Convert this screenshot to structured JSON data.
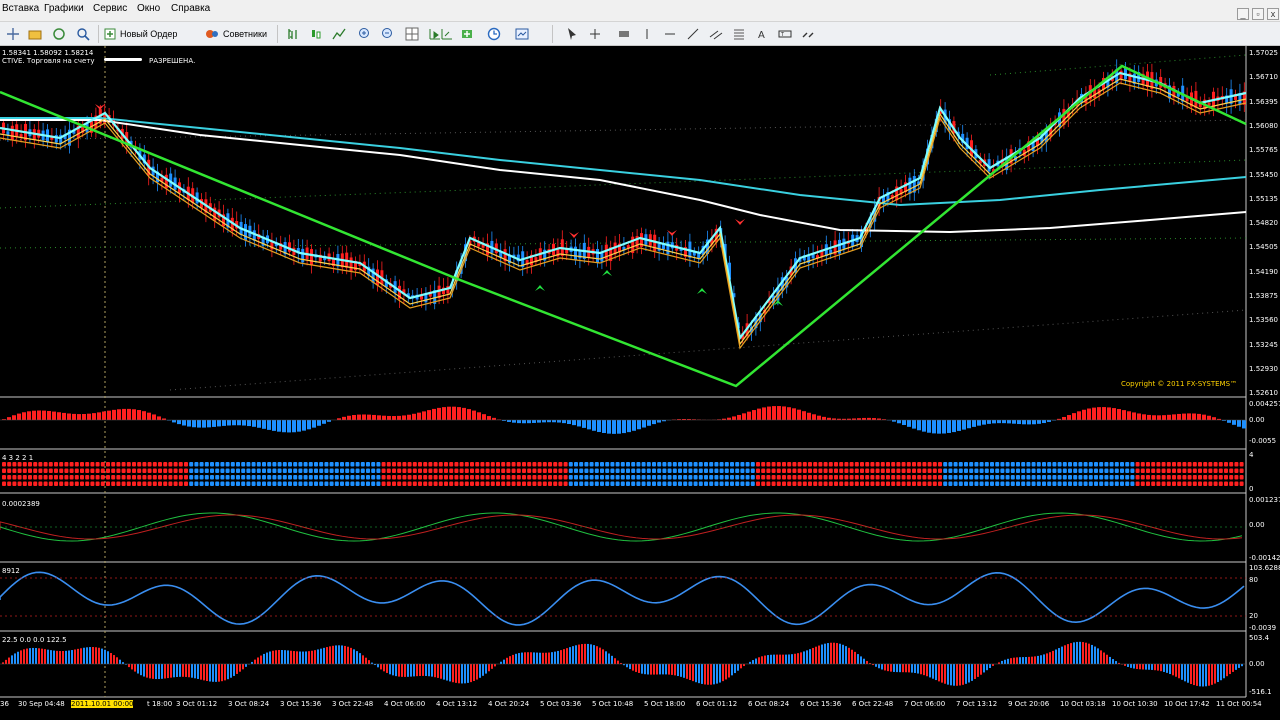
{
  "menu": [
    "Вставка",
    "Графики",
    "Сервис",
    "Окно",
    "Справка"
  ],
  "toolbar": {
    "new_order_label": "Новый Ордер",
    "advisors_label": "Советники"
  },
  "header": {
    "ohlc": "1.58341 1.58092 1.58214",
    "status_prefix": "CTIVE. Торговля на счету",
    "status_suffix": "РАЗРЕШЕНА."
  },
  "price_axis": [
    "1.57025",
    "1.56710",
    "1.56395",
    "1.56080",
    "1.55765",
    "1.55450",
    "1.55135",
    "1.54820",
    "1.54505",
    "1.54190",
    "1.53875",
    "1.53560",
    "1.53245",
    "1.52930",
    "1.52610"
  ],
  "copyright": "Copyright © 2011 FX-SYSTEMS™",
  "sub1": {
    "axis": [
      "0.004257",
      "0.00",
      "-0.0055"
    ]
  },
  "sub2": {
    "label": "4 3 2 2 1",
    "axis": [
      "4",
      "0"
    ]
  },
  "sub3": {
    "label": "0.0002389",
    "axis": [
      "0.001237",
      "0.00",
      "-0.00142"
    ]
  },
  "sub4": {
    "label": "8912",
    "axis": [
      "103.6288",
      "80",
      "20",
      "-0.0039"
    ]
  },
  "sub5": {
    "label": "22.5 0.0 0.0 122.5",
    "axis": [
      "503.4",
      "0.00",
      "-516.1"
    ]
  },
  "time_axis": [
    "36",
    "30 Sep 04:48",
    "2011.10.01 00:00",
    "t 18:00",
    "3 Oct 01:12",
    "3 Oct 08:24",
    "3 Oct 15:36",
    "3 Oct 22:48",
    "4 Oct 06:00",
    "4 Oct 13:12",
    "4 Oct 20:24",
    "5 Oct 03:36",
    "5 Oct 10:48",
    "5 Oct 18:00",
    "6 Oct 01:12",
    "6 Oct 08:24",
    "6 Oct 15:36",
    "6 Oct 22:48",
    "7 Oct 06:00",
    "7 Oct 13:12",
    "9 Oct 20:06",
    "10 Oct 03:18",
    "10 Oct 10:30",
    "10 Oct 17:42",
    "11 Oct 00:54"
  ],
  "colors": {
    "bull": "#1e90ff",
    "bear": "#ff2020",
    "trendline": "#32e632",
    "ma_cyan": "#7fffff",
    "ma_white": "#ffffff",
    "ma_yellow": "#ffd24a"
  }
}
